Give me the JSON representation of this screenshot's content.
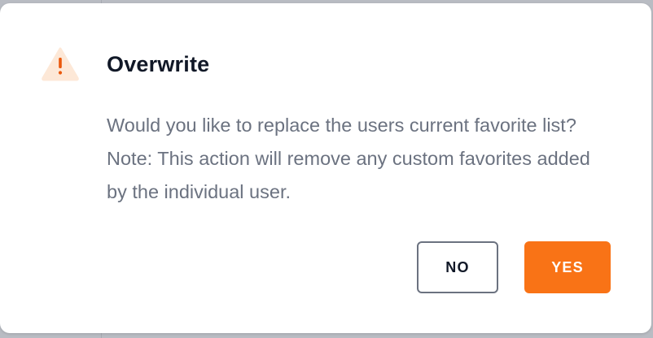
{
  "dialog": {
    "icon": "warning-triangle-icon",
    "title": "Overwrite",
    "message": "Would you like to replace the users current favorite list? Note: This action will remove any custom favorites added by the individual user.",
    "buttons": {
      "no_label": "NO",
      "yes_label": "YES"
    }
  },
  "colors": {
    "accent": "#f97316",
    "warning_icon_bg": "#fde8d7",
    "title_text": "#111827",
    "body_text": "#6b7280"
  }
}
